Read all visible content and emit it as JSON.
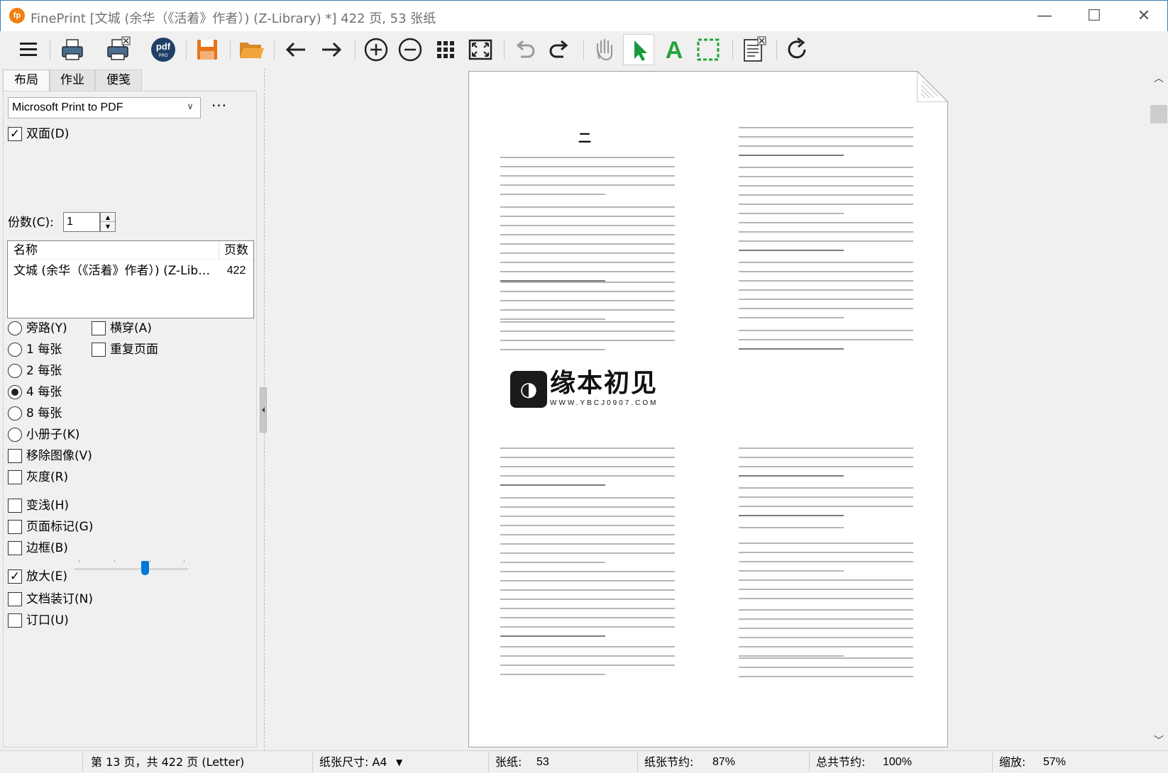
{
  "window": {
    "app_icon_text": "fp",
    "title": "FinePrint [文城 (余华（《活着》作者）) (Z-Library) *] 422 页, 53 张纸",
    "controls": {
      "minimize": "—",
      "maximize": "☐",
      "close": "✕"
    }
  },
  "toolbar": {
    "icons": [
      "menu-icon",
      "print-icon",
      "print-cancel-icon",
      "pdf-pro-icon",
      "save-icon",
      "open-folder-icon",
      "arrow-left-icon",
      "arrow-right-icon",
      "zoom-in-icon",
      "zoom-out-icon",
      "grid-icon",
      "fit-page-icon",
      "undo-icon",
      "redo-icon",
      "hand-icon",
      "select-arrow-icon",
      "text-tool-icon",
      "marquee-icon",
      "delete-page-icon",
      "refresh-icon"
    ],
    "pdf_label": "pdf",
    "pdf_sub": "PRO",
    "text_tool_label": "A",
    "colors": {
      "accent": "#0078d7",
      "save": "#e8731a",
      "folder": "#f2a53c",
      "select": "#1a9a3a",
      "text": "#23a33c"
    }
  },
  "tabs": [
    {
      "label": "布局",
      "active": true
    },
    {
      "label": "作业",
      "active": false
    },
    {
      "label": "便笺",
      "active": false
    }
  ],
  "settings": {
    "printer": "Microsoft Print to PDF",
    "printer_arrow": "∨",
    "more": "···",
    "duplex": {
      "label": "双面(D)",
      "checked": true
    },
    "copies": {
      "label": "份数(C):",
      "value": "1"
    },
    "spin_up": "▲",
    "spin_down": "▼",
    "check_mark": "✓"
  },
  "doc_list": {
    "col_name": "名称",
    "col_pages": "页数",
    "rows": [
      {
        "name": "文城 (余华（《活着》作者）) (Z-Library)",
        "pages": "422"
      }
    ]
  },
  "layout_options": {
    "bypass": "旁路(Y)",
    "landscape": "横穿(A)",
    "repeat_pages": "重复页面",
    "one_per_sheet": "1 每张",
    "two_per_sheet": "2 每张",
    "four_per_sheet": "4 每张",
    "eight_per_sheet": "8 每张",
    "booklet": "小册子(K)",
    "selected": "4 每张"
  },
  "options": {
    "remove_images": {
      "label": "移除图像(V)",
      "checked": false
    },
    "grayscale": {
      "label": "灰度(R)",
      "checked": false
    },
    "lighten": {
      "label": "变浅(H)",
      "checked": false
    },
    "page_marks": {
      "label": "页面标记(G)",
      "checked": false
    },
    "border": {
      "label": "边框(B)",
      "checked": false
    },
    "enlarge": {
      "label": "放大(E)",
      "checked": true
    },
    "binding": {
      "label": "文档装订(N)",
      "checked": false
    },
    "staple": {
      "label": "订口(U)",
      "checked": false
    },
    "enlarge_level": 0.62
  },
  "preview": {
    "chapter_mark": "二",
    "watermark_title": "缘本初见",
    "watermark_url": "WWW.YBCJ0907.COM",
    "watermark_icon": "◑"
  },
  "scrollbar": {
    "up": "︿",
    "down": "﹀"
  },
  "status": {
    "page_info": "第 13 页，共 422 页 (Letter)",
    "paper_size": "纸张尺寸: A4",
    "paper_dropdown": "▼",
    "sheets_label": "张纸:",
    "sheets_value": "53",
    "paper_saving_label": "纸张节约:",
    "paper_saving_value": "87%",
    "total_saving_label": "总共节约:",
    "total_saving_value": "100%",
    "zoom_label": "缩放:",
    "zoom_value": "57%"
  }
}
